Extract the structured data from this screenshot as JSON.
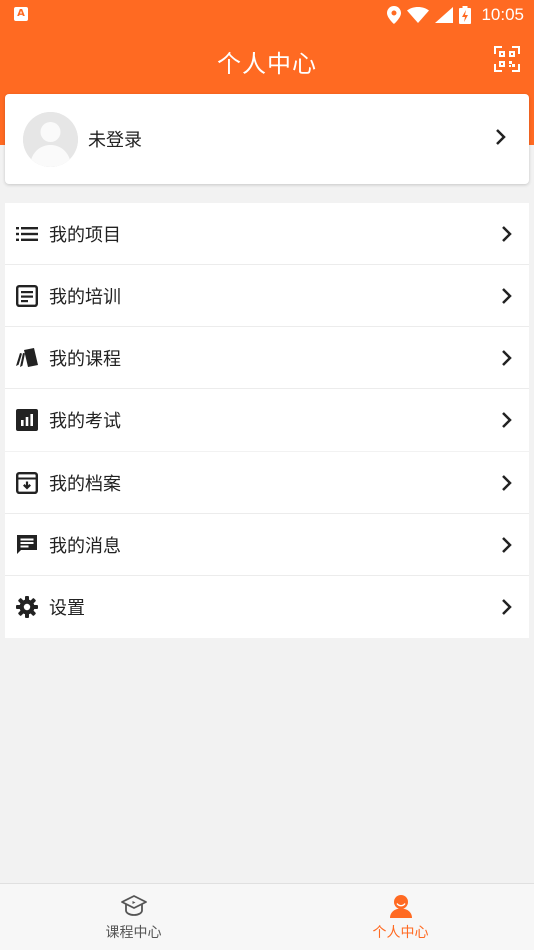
{
  "status_bar": {
    "time": "10:05"
  },
  "header": {
    "title": "个人中心",
    "qr_icon": "qr-scan-icon"
  },
  "profile": {
    "name": "未登录",
    "avatar_icon": "default-avatar-icon"
  },
  "menu_group_1": [
    {
      "id": "projects",
      "label": "我的项目",
      "icon": "list-icon"
    },
    {
      "id": "training",
      "label": "我的培训",
      "icon": "document-icon"
    },
    {
      "id": "courses",
      "label": "我的课程",
      "icon": "cards-icon"
    },
    {
      "id": "exams",
      "label": "我的考试",
      "icon": "bar-chart-icon"
    }
  ],
  "menu_group_2": [
    {
      "id": "archives",
      "label": "我的档案",
      "icon": "archive-icon"
    },
    {
      "id": "messages",
      "label": "我的消息",
      "icon": "message-icon"
    },
    {
      "id": "settings",
      "label": "设置",
      "icon": "gear-icon"
    }
  ],
  "bottom_nav": [
    {
      "id": "course-center",
      "label": "课程中心",
      "icon": "graduation-cap-icon",
      "active": false
    },
    {
      "id": "personal-center",
      "label": "个人中心",
      "icon": "person-icon",
      "active": true
    }
  ],
  "colors": {
    "accent": "#ff6a22",
    "background": "#f2f2f2"
  }
}
